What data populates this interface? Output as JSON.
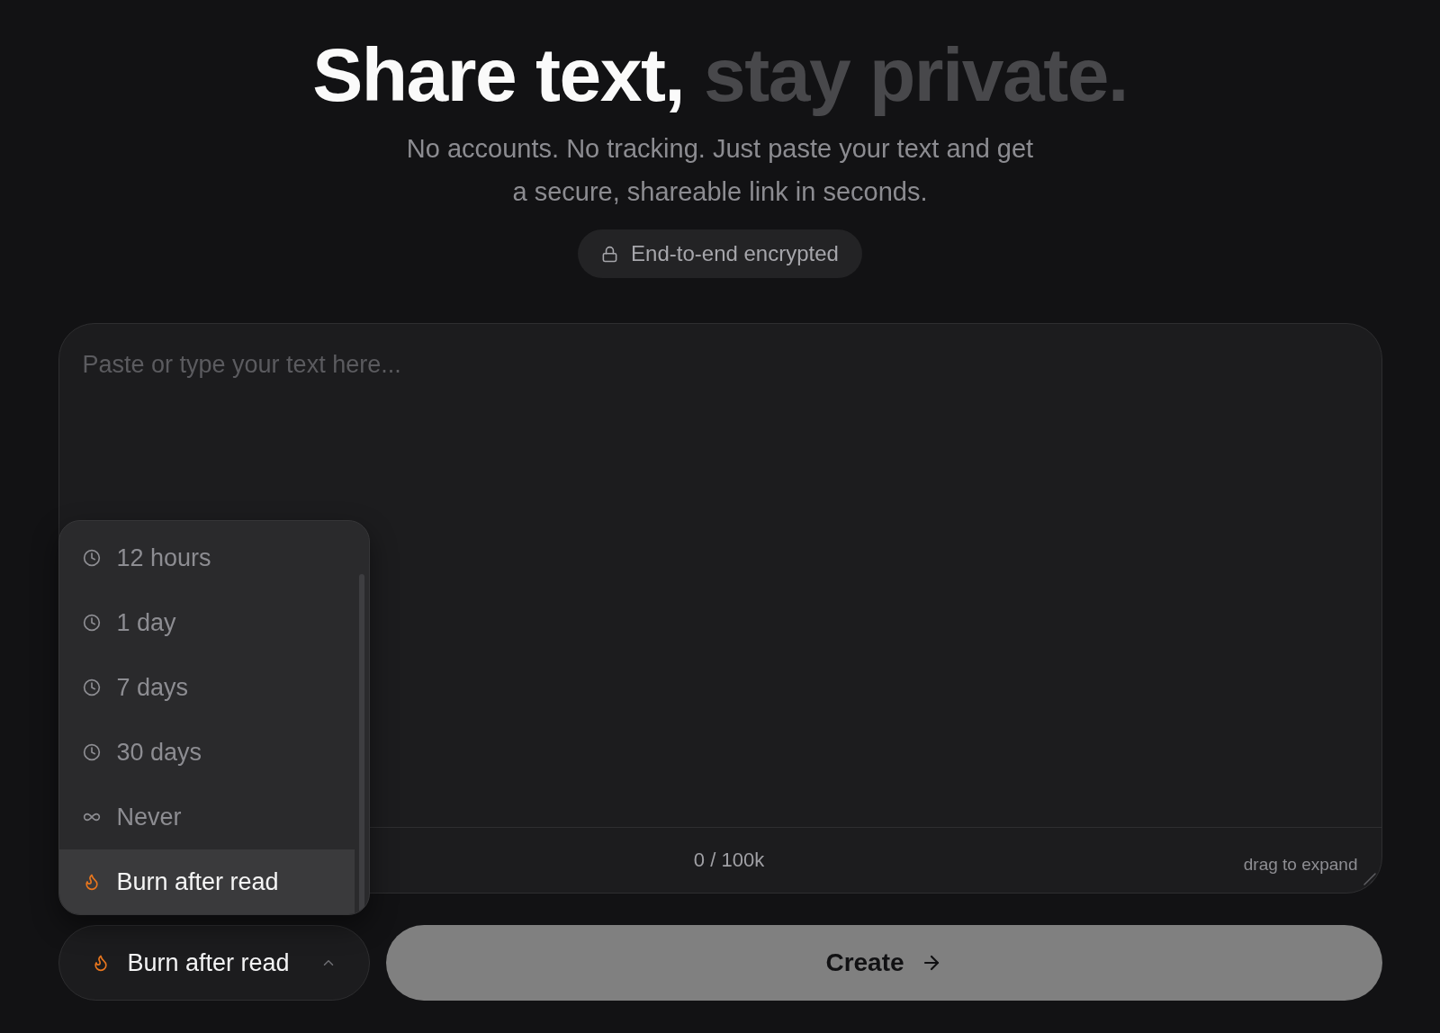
{
  "hero": {
    "title": {
      "main": "Share text,",
      "accent": "stay private."
    },
    "subtitle": "No accounts. No tracking. Just paste your text and get a secure, shareable link in seconds.",
    "badge": {
      "label": "End-to-end encrypted"
    }
  },
  "editor": {
    "placeholder": "Paste or type your text here...",
    "counter": "0 / 100k",
    "resize_hint": "drag to expand"
  },
  "expiry_menu": {
    "options": [
      {
        "label": "12 hours",
        "kind": "clock",
        "selected": false
      },
      {
        "label": "1 day",
        "kind": "clock",
        "selected": false
      },
      {
        "label": "7 days",
        "kind": "clock",
        "selected": false
      },
      {
        "label": "30 days",
        "kind": "clock",
        "selected": false
      },
      {
        "label": "Never",
        "kind": "infinity",
        "selected": false
      },
      {
        "label": "Burn after read",
        "kind": "flame",
        "selected": true
      }
    ]
  },
  "expiry_select": {
    "label": "Burn after read",
    "expanded": true
  },
  "create_button": {
    "label": "Create",
    "disabled": true
  }
}
